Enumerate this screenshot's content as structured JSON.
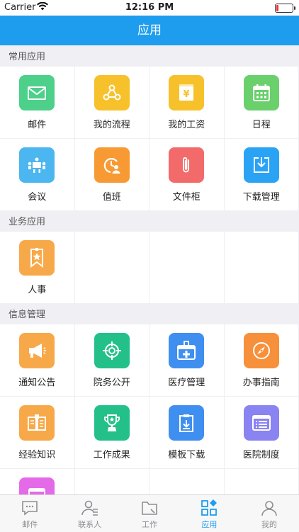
{
  "status": {
    "carrier": "Carrier",
    "time": "12:16 PM"
  },
  "nav": {
    "title": "应用"
  },
  "sections": [
    {
      "title": "常用应用",
      "items": [
        {
          "label": "邮件",
          "color": "#4cd08a",
          "icon": "mail-icon"
        },
        {
          "label": "我的流程",
          "color": "#f7c12b",
          "icon": "workflow-icon"
        },
        {
          "label": "我的工资",
          "color": "#f7c12b",
          "icon": "salary-icon"
        },
        {
          "label": "日程",
          "color": "#6ad06c",
          "icon": "calendar-icon"
        },
        {
          "label": "会议",
          "color": "#4bb6f0",
          "icon": "meeting-icon"
        },
        {
          "label": "值班",
          "color": "#f79a33",
          "icon": "duty-icon"
        },
        {
          "label": "文件柜",
          "color": "#f36a6a",
          "icon": "paperclip-icon"
        },
        {
          "label": "下载管理",
          "color": "#2aa3f5",
          "icon": "download-icon"
        }
      ]
    },
    {
      "title": "业务应用",
      "items": [
        {
          "label": "人事",
          "color": "#f7a94a",
          "icon": "personnel-icon"
        }
      ]
    },
    {
      "title": "信息管理",
      "items": [
        {
          "label": "通知公告",
          "color": "#f7a94a",
          "icon": "megaphone-icon"
        },
        {
          "label": "院务公开",
          "color": "#24c08a",
          "icon": "target-icon"
        },
        {
          "label": "医疗管理",
          "color": "#3f8ff0",
          "icon": "medical-kit-icon"
        },
        {
          "label": "办事指南",
          "color": "#f7903a",
          "icon": "compass-icon"
        },
        {
          "label": "经验知识",
          "color": "#f7a94a",
          "icon": "book-icon"
        },
        {
          "label": "工作成果",
          "color": "#24c08a",
          "icon": "trophy-icon"
        },
        {
          "label": "模板下载",
          "color": "#3f8ff0",
          "icon": "template-download-icon"
        },
        {
          "label": "医院制度",
          "color": "#8a83f2",
          "icon": "rules-icon"
        },
        {
          "label": "",
          "color": "#e46ae8",
          "icon": "app-icon"
        }
      ]
    }
  ],
  "tabs": [
    {
      "label": "邮件",
      "icon": "chat-icon"
    },
    {
      "label": "联系人",
      "icon": "contacts-icon"
    },
    {
      "label": "工作",
      "icon": "folder-icon"
    },
    {
      "label": "应用",
      "icon": "apps-icon",
      "active": true
    },
    {
      "label": "我的",
      "icon": "profile-icon"
    }
  ],
  "colors": {
    "accent": "#1e9dee",
    "battery": "#e53935"
  }
}
